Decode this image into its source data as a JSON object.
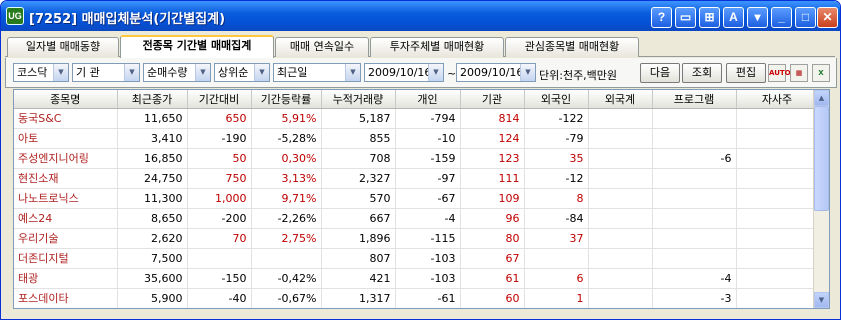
{
  "window": {
    "title": "[7252] 매매입체분석(기간별집계)",
    "app_icon": "UG"
  },
  "title_buttons": [
    "?",
    "▭",
    "⊞",
    "A",
    "▾"
  ],
  "tabs": [
    "일자별 매매동향",
    "전종목 기간별 매매집계",
    "매매 연속일수",
    "투자주체별 매매현황",
    "관심종목별 매매현황"
  ],
  "toolbar": {
    "market": "코스닥",
    "investor": "기 관",
    "sort_by": "순매수량",
    "order": "상위순",
    "period": "최근일",
    "date_from": "2009/10/16",
    "date_sep": "~",
    "date_to": "2009/10/16",
    "unit": "단위:천주,백만원",
    "next": "다음",
    "query": "조회",
    "edit": "편집"
  },
  "columns": [
    "종목명",
    "최근종가",
    "기간대비",
    "기간등락률",
    "누적거래량",
    "개인",
    "기관",
    "외국인",
    "외국계",
    "프로그램",
    "자사주"
  ],
  "rows": [
    [
      "동국S&C",
      "11,650",
      "650",
      "5,91%",
      "5,187",
      "-794",
      "814",
      "-122",
      "",
      "",
      ""
    ],
    [
      "아토",
      "3,410",
      "-190",
      "-5,28%",
      "855",
      "-10",
      "124",
      "-79",
      "",
      "",
      ""
    ],
    [
      "주성엔지니어링",
      "16,850",
      "50",
      "0,30%",
      "708",
      "-159",
      "123",
      "35",
      "",
      "-6",
      ""
    ],
    [
      "현진소재",
      "24,750",
      "750",
      "3,13%",
      "2,327",
      "-97",
      "111",
      "-12",
      "",
      "",
      ""
    ],
    [
      "나노트로닉스",
      "11,300",
      "1,000",
      "9,71%",
      "570",
      "-67",
      "109",
      "8",
      "",
      "",
      ""
    ],
    [
      "예스24",
      "8,650",
      "-200",
      "-2,26%",
      "667",
      "-4",
      "96",
      "-84",
      "",
      "",
      ""
    ],
    [
      "우리기술",
      "2,620",
      "70",
      "2,75%",
      "1,896",
      "-115",
      "80",
      "37",
      "",
      "",
      ""
    ],
    [
      "더존디지털",
      "7,500",
      "",
      "",
      "807",
      "-103",
      "67",
      "",
      "",
      "",
      ""
    ],
    [
      "태광",
      "35,600",
      "-150",
      "-0,42%",
      "421",
      "-103",
      "61",
      "6",
      "",
      "-4",
      ""
    ],
    [
      "포스데이타",
      "5,900",
      "-40",
      "-0,67%",
      "1,317",
      "-61",
      "60",
      "1",
      "",
      "-3",
      ""
    ]
  ]
}
